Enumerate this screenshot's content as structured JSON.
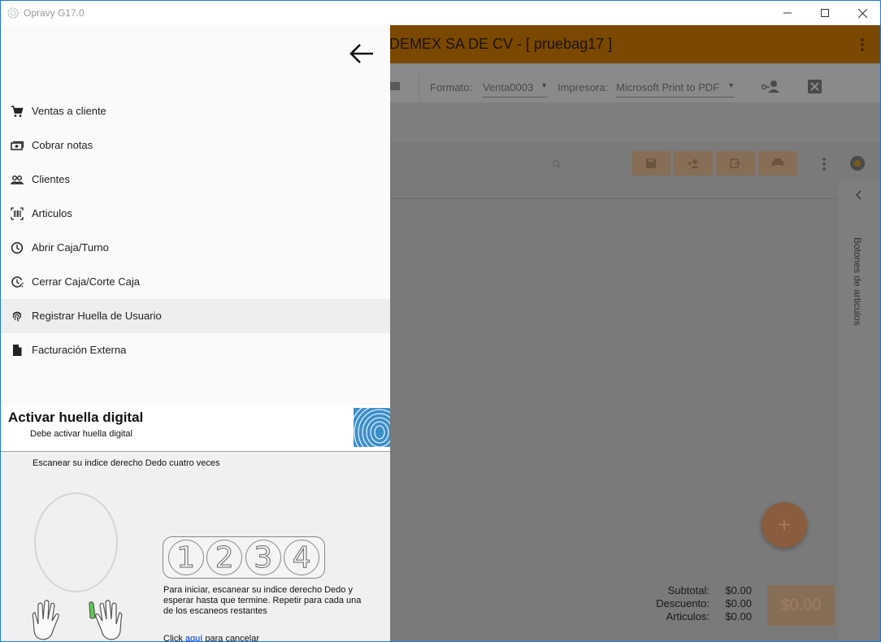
{
  "window": {
    "title": "Opravy G17.0"
  },
  "app": {
    "company": "DEMEX SA DE CV - [ pruebag17 ]",
    "toolbar": {
      "formato_label": "Formato:",
      "formato_value": "Venta0003",
      "impresora_label": "Impresora:",
      "impresora_value": "Microsoft Print to PDF"
    },
    "side_panel_label": "Botones de articulos",
    "fab_label": "+",
    "totals": {
      "subtotal_label": "Subtotal:",
      "subtotal_value": "$0.00",
      "descuento_label": "Descuento:",
      "descuento_value": "$0.00",
      "articulos_label": "Articulos:",
      "articulos_value": "$0.00",
      "total_button": "$0.00"
    }
  },
  "drawer": {
    "items": [
      {
        "label": "Ventas a cliente",
        "icon": "cart-icon"
      },
      {
        "label": "Cobrar notas",
        "icon": "cash-icon"
      },
      {
        "label": "Clientes",
        "icon": "people-icon"
      },
      {
        "label": "Articulos",
        "icon": "barcode-icon"
      },
      {
        "label": "Abrir Caja/Turno",
        "icon": "clock-icon"
      },
      {
        "label": "Cerrar Caja/Corte Caja",
        "icon": "clock-history-icon"
      },
      {
        "label": "Registrar Huella de Usuario",
        "icon": "fingerprint-icon"
      },
      {
        "label": "Facturación Externa",
        "icon": "document-icon"
      }
    ]
  },
  "fingerprint_dialog": {
    "title": "Activar huella digital",
    "subtitle": "Debe activar huella digital",
    "instruction": "Escanear su indice derecho Dedo cuatro veces",
    "counter": [
      "1",
      "2",
      "3",
      "4"
    ],
    "help": "Para iniciar, escanear su indice derecho Dedo y esperar hasta que termine. Repetir para cada una de los escaneos restantes",
    "cancel_prefix": "Click ",
    "cancel_link": "aquí",
    "cancel_suffix": " para cancelar"
  }
}
